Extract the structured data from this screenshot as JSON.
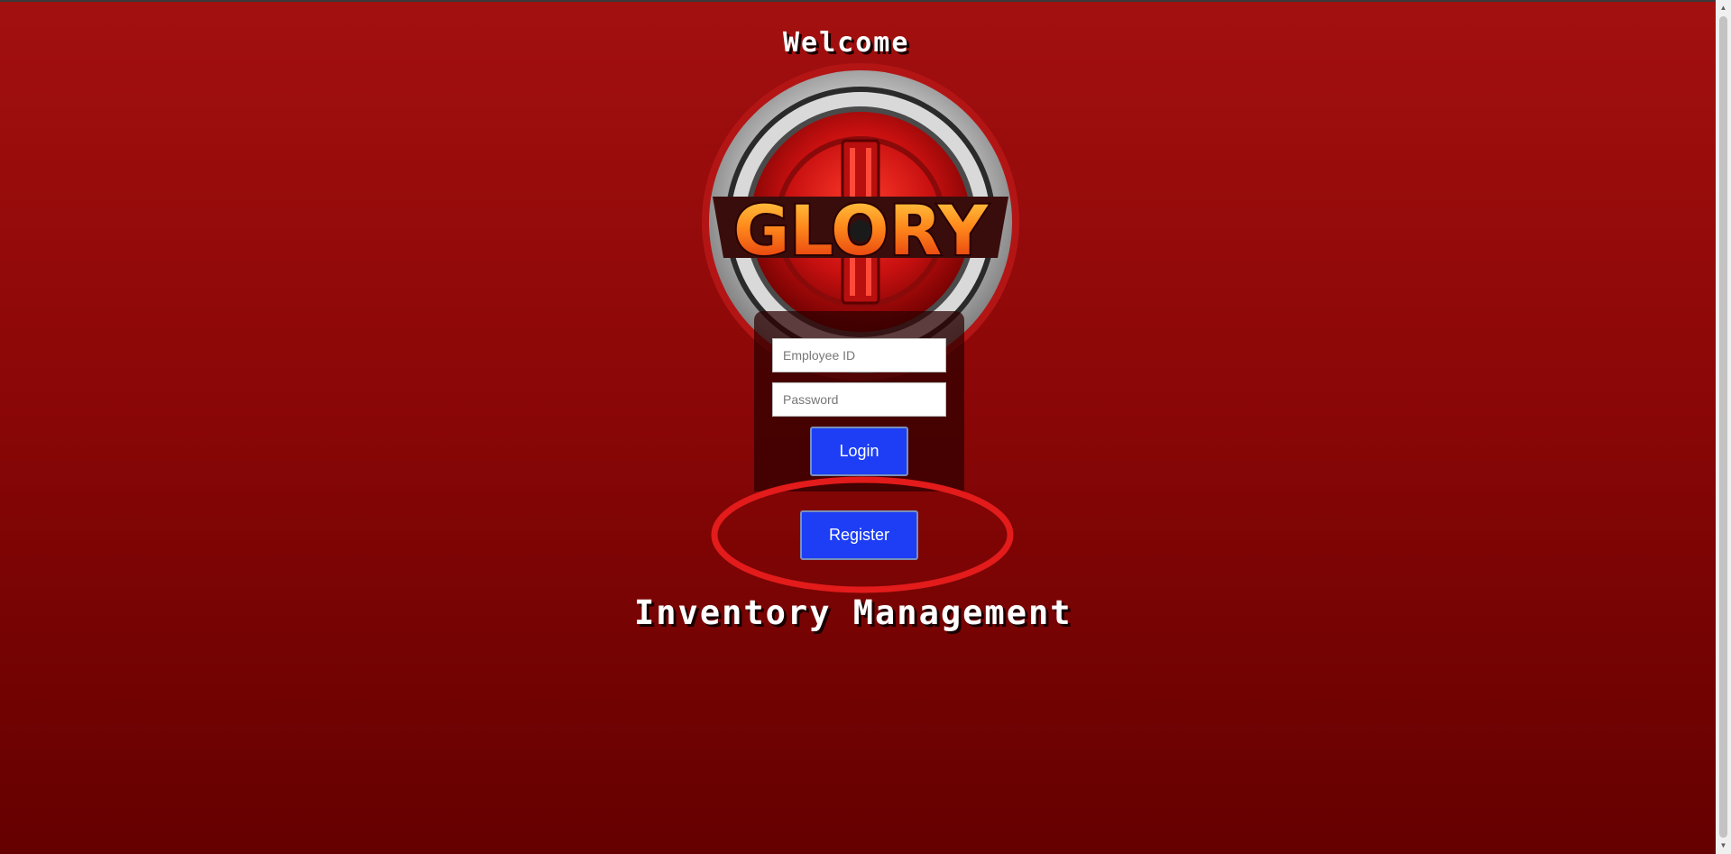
{
  "header": {
    "title": "Welcome"
  },
  "logo": {
    "text": "GLORY",
    "icon": "glory-emblem-logo"
  },
  "form": {
    "employee_id_placeholder": "Employee ID",
    "employee_id_value": "",
    "password_placeholder": "Password",
    "password_value": "",
    "login_label": "Login",
    "register_label": "Register"
  },
  "footer": {
    "subtitle": "Inventory Management"
  },
  "colors": {
    "background_top": "#a31010",
    "background_bottom": "#650000",
    "button": "#1d3ef5",
    "annotation_ring": "#e31b1b",
    "panel": "#2d0000"
  }
}
